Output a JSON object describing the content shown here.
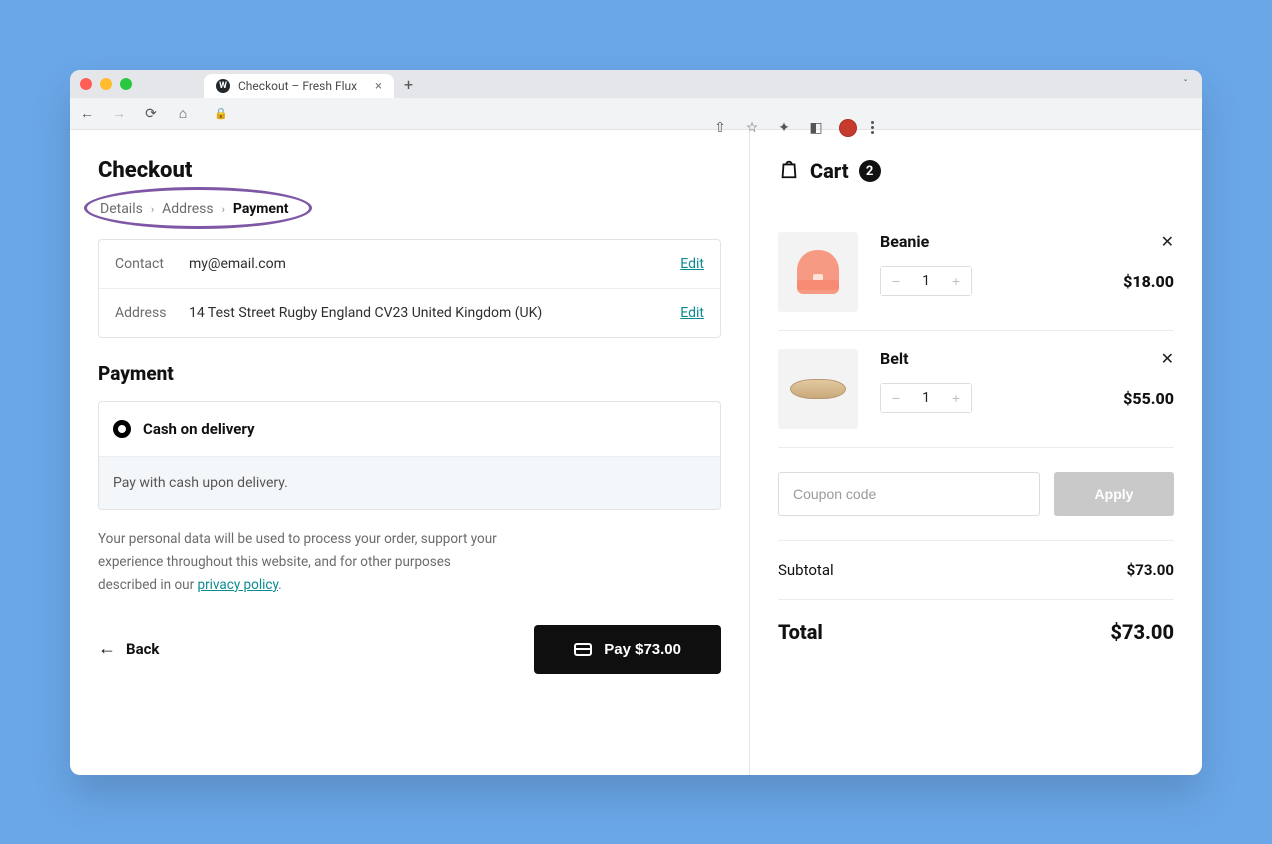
{
  "browser": {
    "tab_title": "Checkout – Fresh Flux"
  },
  "checkout": {
    "title": "Checkout",
    "breadcrumb": {
      "step1": "Details",
      "step2": "Address",
      "step3": "Payment"
    },
    "summary": {
      "contact_label": "Contact",
      "contact_value": "my@email.com",
      "address_label": "Address",
      "address_value": "14 Test Street Rugby England CV23 United Kingdom (UK)",
      "edit": "Edit"
    },
    "payment": {
      "heading": "Payment",
      "option_label": "Cash on delivery",
      "option_desc": "Pay with cash upon delivery."
    },
    "privacy": {
      "text_a": "Your personal data will be used to process your order, support your experience throughout this website, and for other purposes described in our ",
      "link": "privacy policy",
      "text_b": "."
    },
    "actions": {
      "back": "Back",
      "pay": "Pay $73.00"
    }
  },
  "cart": {
    "title": "Cart",
    "count": "2",
    "items": [
      {
        "name": "Beanie",
        "qty": "1",
        "price": "$18.00"
      },
      {
        "name": "Belt",
        "qty": "1",
        "price": "$55.00"
      }
    ],
    "coupon_placeholder": "Coupon code",
    "apply": "Apply",
    "subtotal_label": "Subtotal",
    "subtotal_value": "$73.00",
    "total_label": "Total",
    "total_value": "$73.00"
  }
}
